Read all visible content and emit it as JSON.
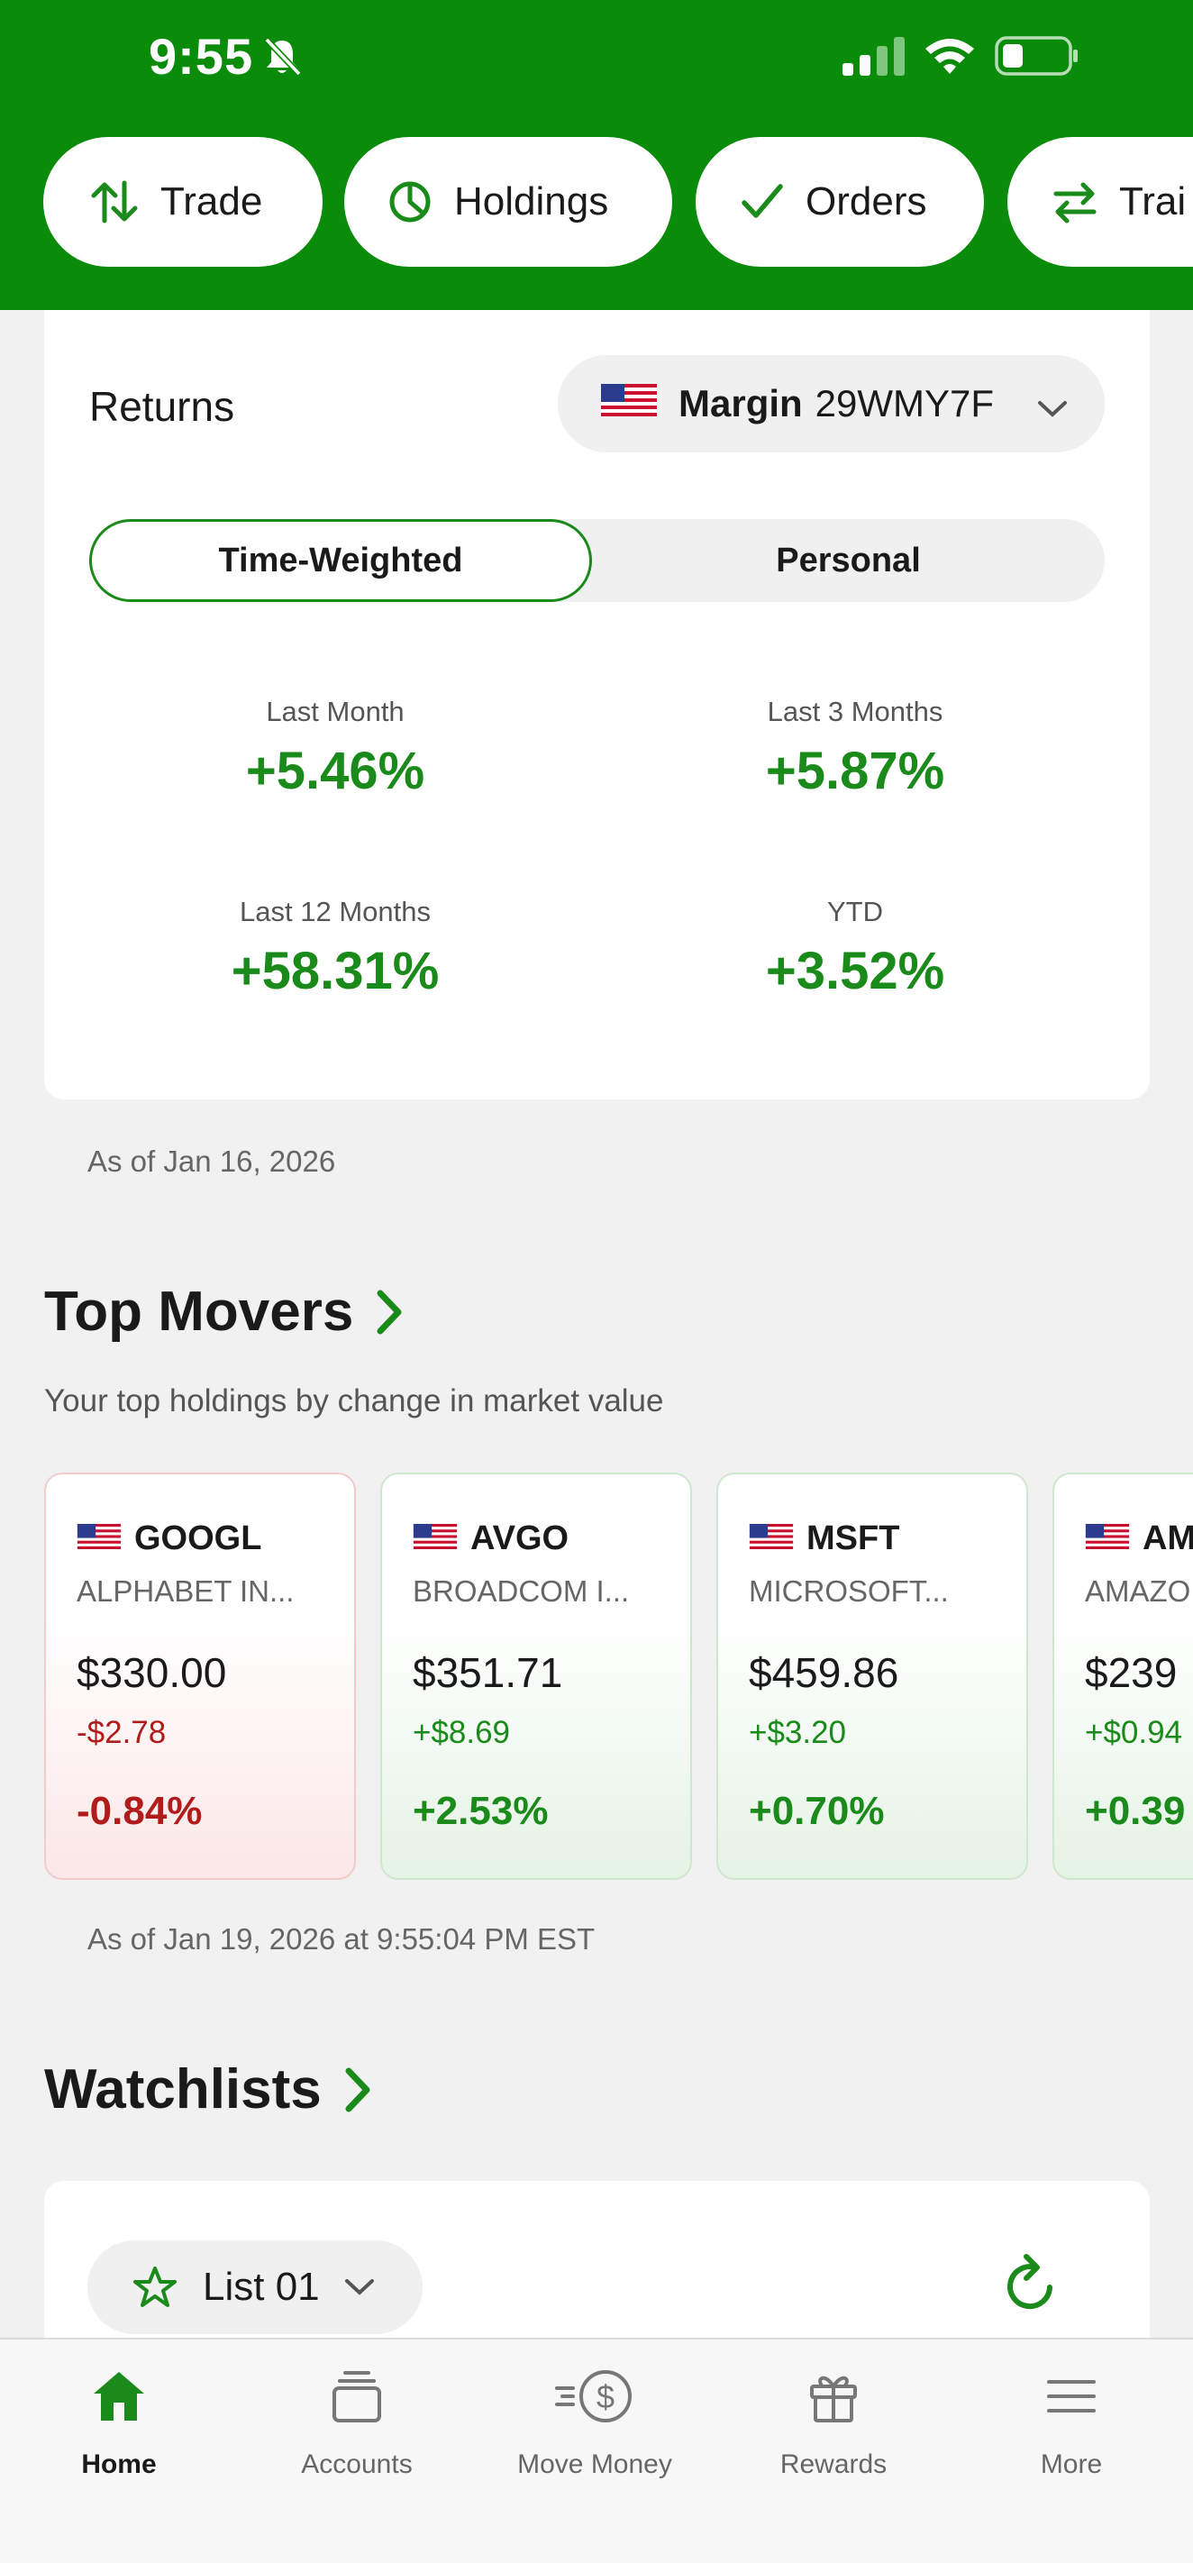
{
  "status_bar": {
    "time": "9:55"
  },
  "quick_actions": [
    {
      "label": "Trade",
      "icon": "arrows-up-down-icon"
    },
    {
      "label": "Holdings",
      "icon": "pie-chart-icon"
    },
    {
      "label": "Orders",
      "icon": "check-icon"
    },
    {
      "label": "Trai",
      "icon": "transfer-arrows-icon"
    }
  ],
  "returns": {
    "title": "Returns",
    "account_type": "Margin",
    "account_id": "29WMY7F",
    "tabs": [
      {
        "label": "Time-Weighted",
        "active": true
      },
      {
        "label": "Personal",
        "active": false
      }
    ],
    "metrics": [
      {
        "label": "Last Month",
        "value": "+5.46%"
      },
      {
        "label": "Last 3 Months",
        "value": "+5.87%"
      },
      {
        "label": "Last 12 Months",
        "value": "+58.31%"
      },
      {
        "label": "YTD",
        "value": "+3.52%"
      }
    ],
    "as_of": "As of Jan 16, 2026"
  },
  "top_movers": {
    "title": "Top Movers",
    "subtitle": "Your top holdings by change in market value",
    "items": [
      {
        "symbol": "GOOGL",
        "name": "ALPHABET IN...",
        "price": "$330.00",
        "change": "-$2.78",
        "percent": "-0.84%",
        "direction": "down"
      },
      {
        "symbol": "AVGO",
        "name": "BROADCOM I...",
        "price": "$351.71",
        "change": "+$8.69",
        "percent": "+2.53%",
        "direction": "up"
      },
      {
        "symbol": "MSFT",
        "name": "MICROSOFT...",
        "price": "$459.86",
        "change": "+$3.20",
        "percent": "+0.70%",
        "direction": "up"
      },
      {
        "symbol": "AM",
        "name": "AMAZO",
        "price": "$239",
        "change": "+$0.94",
        "percent": "+0.39",
        "direction": "up"
      }
    ],
    "as_of": "As of Jan 19, 2026 at 9:55:04 PM EST"
  },
  "watchlists": {
    "title": "Watchlists",
    "selected_list": "List 01"
  },
  "bottom_nav": [
    {
      "label": "Home",
      "icon": "home-icon",
      "active": true
    },
    {
      "label": "Accounts",
      "icon": "accounts-icon",
      "active": false
    },
    {
      "label": "Move Money",
      "icon": "move-money-icon",
      "active": false
    },
    {
      "label": "Rewards",
      "icon": "gift-icon",
      "active": false
    },
    {
      "label": "More",
      "icon": "menu-icon",
      "active": false
    }
  ],
  "colors": {
    "brand_green": "#0a8c0a",
    "positive": "#1a8a1a",
    "negative": "#b01c1c",
    "background": "#f1f1f1"
  }
}
